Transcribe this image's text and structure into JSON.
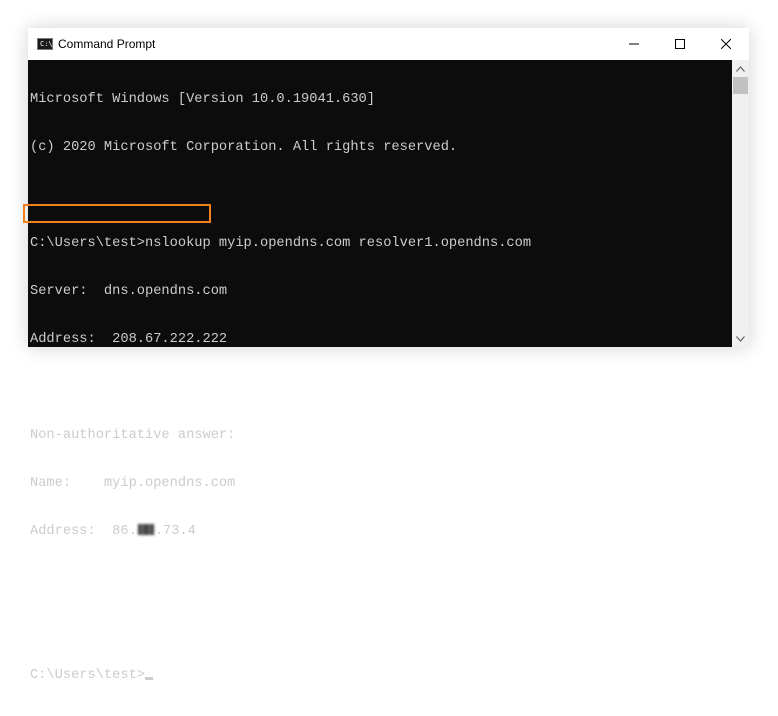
{
  "window": {
    "title": "Command Prompt",
    "icon": "cmd-icon",
    "icon_glyph": "C:\\"
  },
  "controls": {
    "minimize_icon": "minimize-icon",
    "maximize_icon": "maximize-icon",
    "close_icon": "close-icon"
  },
  "console": {
    "background": "#0c0c0c",
    "text_color": "#cccccc",
    "line_1": "Microsoft Windows [Version 10.0.19041.630]",
    "line_2": "(c) 2020 Microsoft Corporation. All rights reserved.",
    "line_3": "",
    "line_4": "C:\\Users\\test>nslookup myip.opendns.com resolver1.opendns.com",
    "line_5": "Server:  dns.opendns.com",
    "line_6": "Address:  208.67.222.222",
    "line_7": "",
    "line_8": "Non-authoritative answer:",
    "line_9": "Name:    myip.opendns.com",
    "line_10_prefix": "Address:  86.",
    "line_10_suffix": ".73.4",
    "line_11": "",
    "line_12": "",
    "line_13": "C:\\Users\\test>"
  },
  "highlight": {
    "color": "#f2801f"
  },
  "scrollbar": {
    "up_icon": "scroll-up-arrow-icon",
    "down_icon": "scroll-down-arrow-icon"
  }
}
